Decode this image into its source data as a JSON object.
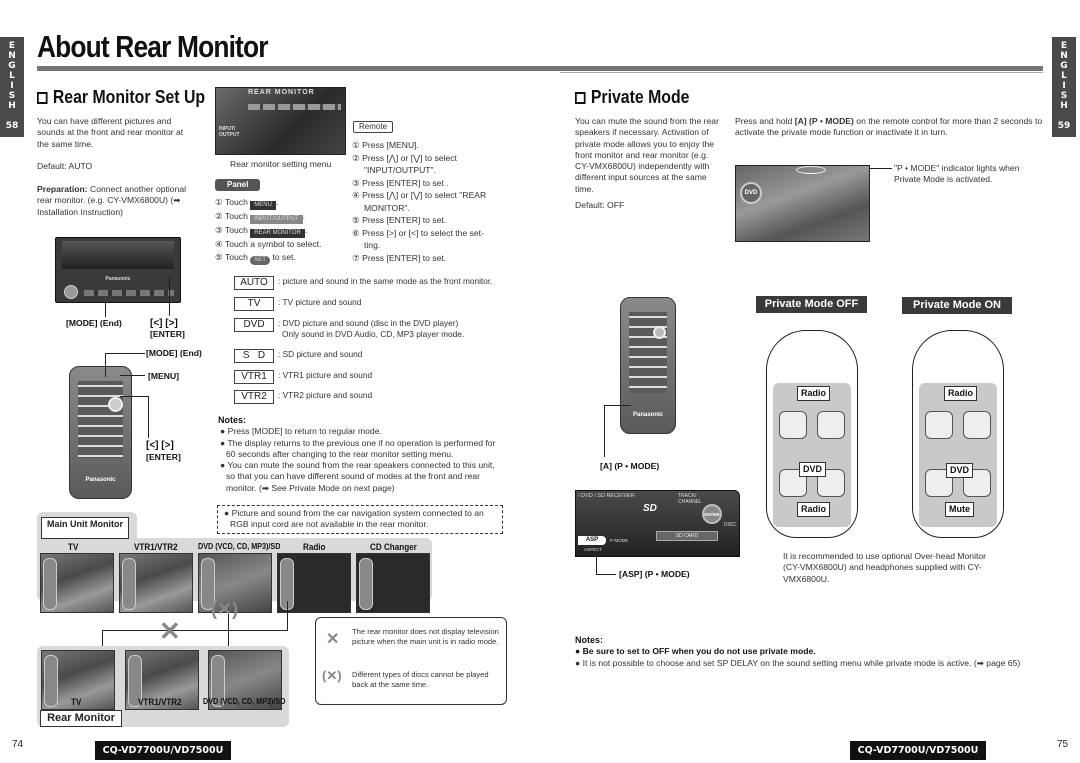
{
  "language_tab": {
    "letters": [
      "E",
      "N",
      "G",
      "L",
      "I",
      "S",
      "H"
    ],
    "left_page": "58",
    "right_page": "59"
  },
  "title": "About Rear Monitor",
  "left": {
    "section_title": "Rear Monitor Set Up",
    "intro": "You can have different pictures and sounds at the front  and rear monitor at the same time.",
    "default": "Default: AUTO",
    "preparation_label": "Preparation:",
    "preparation_text": " Connect another optional rear monitor.  (e.g. CY-VMX6800U) (➡ Installation Instruction)",
    "menu_caption": "Rear monitor setting menu",
    "menu_screen": {
      "title": "REAR MONITOR",
      "side_label": "INPUT/ OUTPUT"
    },
    "panel": {
      "label": "Panel",
      "steps": [
        {
          "num": "①",
          "pre": "Touch",
          "chip": "MENU",
          "post": "."
        },
        {
          "num": "②",
          "pre": "Touch",
          "chip": "INPUT/OUTPUT",
          "post": "."
        },
        {
          "num": "③",
          "pre": "Touch",
          "chip": "REAR MONITOR",
          "post": "."
        },
        {
          "num": "④",
          "pre": "Touch a symbol to select.",
          "chip": "",
          "post": ""
        },
        {
          "num": "⑤",
          "pre": "Touch",
          "chip": "SET",
          "post": "to set."
        }
      ]
    },
    "remote": {
      "label": "Remote",
      "steps": [
        {
          "num": "①",
          "text": "Press [MENU]."
        },
        {
          "num": "②",
          "text": "Press [⋀] or [⋁] to select",
          "cont": "\"INPUT/OUTPUT\"."
        },
        {
          "num": "③",
          "text": "Press [ENTER] to set ."
        },
        {
          "num": "④",
          "text": "Press [⋀] or [⋁] to select \"REAR",
          "cont": "MONITOR\"."
        },
        {
          "num": "⑤",
          "text": "Press [ENTER] to set."
        },
        {
          "num": "⑥",
          "text": "Press [>] or [<] to select the set-",
          "cont": "ting."
        },
        {
          "num": "⑦",
          "text": "Press [ENTER] to set."
        }
      ]
    },
    "modes": [
      {
        "key": "AUTO",
        "desc": ": picture and sound in the same mode as the front monitor."
      },
      {
        "key": "TV",
        "desc": ":  TV picture and sound"
      },
      {
        "key": "DVD",
        "desc": ": DVD picture and sound (disc in the DVD player)",
        "desc2": "Only sound in DVD Audio, CD, MP3 player mode."
      },
      {
        "key": "S   D",
        "desc": ": SD picture and sound"
      },
      {
        "key": "VTR1",
        "desc": ": VTR1 picture and sound"
      },
      {
        "key": "VTR2",
        "desc": ": VTR2 picture and sound"
      }
    ],
    "callouts": {
      "unit_mode": "[MODE] (End)",
      "unit_arrows": "[<] [>]",
      "unit_enter": "[ENTER]",
      "remote_mode": "[MODE] (End)",
      "remote_menu": "[MENU]",
      "remote_arrows": "[<] [>]",
      "remote_enter": "[ENTER]"
    },
    "unit_brand": "Panasonic",
    "remote_brand": "Panasonic",
    "notes_title": "Notes:",
    "notes": [
      "Press [MODE] to return to regular mode.",
      "The display returns to the previous one if no operation is performed for 60 seconds after changing to the rear monitor setting menu.",
      "You can mute the sound from the rear speakers connected to this unit, so that you can have different sound of modes at the front and rear monitor. (➡ See Private Mode on next page)"
    ],
    "boxed_note": "Picture and sound from the car navigation system connected to an RGB input cord are not available in the rear monitor.",
    "diagram": {
      "main_unit_label": "Main Unit Monitor",
      "main_columns": [
        "TV",
        "VTR1/VTR2",
        "DVD (VCD, CD, MP3)/SD",
        "Radio",
        "CD Changer"
      ],
      "rear_columns": [
        "TV",
        "VTR1/VTR2",
        "DVD (VCD, CD, MP3)/SD"
      ],
      "rear_label": "Rear Monitor",
      "legend": [
        {
          "symbol": "✕",
          "text": "The rear monitor does not display television picture when the main unit is in radio mode."
        },
        {
          "symbol": "(✕)",
          "text": "Different types of discs cannot be played back at the same time."
        }
      ]
    },
    "page_number": "74",
    "model": "CQ-VD7700U/VD7500U"
  },
  "right": {
    "section_title": "Private Mode",
    "intro": "You can mute the sound from the rear speakers if necessary. Activation of private mode allows you to enjoy the front monitor and rear monitor (e.g. CY-VMX6800U) independently with different input sources at the same time.",
    "default": "Default: OFF",
    "instruction_pre": "Press and hold ",
    "instruction_bold": "[A] (P • MODE)",
    "instruction_post": " on the remote control for more than 2 seconds to activate the private mode function or inactivate it in turn.",
    "indicator_note": "\"P • MODE\" indicator lights when Private Mode is activated.",
    "screen_disc_label": "DVD",
    "remote_callout": "[A] (P • MODE)",
    "remote_brand": "Panasonic",
    "unit_panel": {
      "receiver_label": "/ DVD / SD RECEIVER",
      "track_label": "TRACK/ CHANNEL",
      "enter": "ENTER",
      "disc": "DISC",
      "sd_card": "SD CARD",
      "asp": "ASP",
      "pmode": "P·MODE",
      "aspect": "ASPECT",
      "sd_logo": "SD"
    },
    "unit_callout": "[ASP] (P • MODE)",
    "mode_off": {
      "label": "Private Mode OFF",
      "front": "Radio",
      "rear_screen": "DVD",
      "rear": "Radio"
    },
    "mode_on": {
      "label": "Private Mode ON",
      "front": "Radio",
      "rear_screen": "DVD",
      "rear": "Mute"
    },
    "recommendation": "It is recommended to use optional Over-head Monitor (CY-VMX6800U) and headphones supplied with CY-VMX6800U.",
    "notes_title": "Notes:",
    "notes": [
      {
        "text": "Be sure to set to OFF when you do not use private mode.",
        "bold": true
      },
      {
        "text": "It is not possible to choose and set SP DELAY on the sound setting menu while private mode is active. (➡ page 65)",
        "bold": false
      }
    ],
    "page_number": "75",
    "model": "CQ-VD7700U/VD7500U"
  }
}
